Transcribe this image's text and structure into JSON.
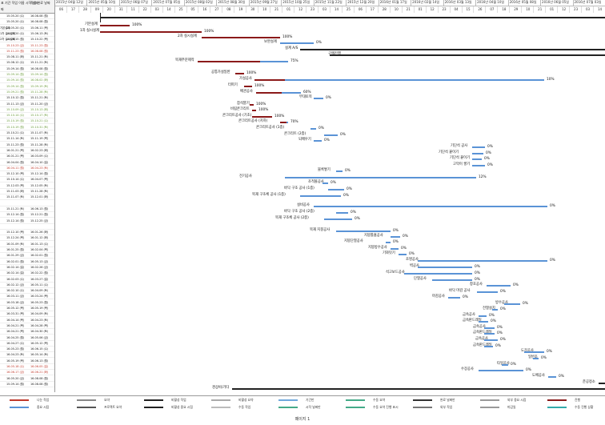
{
  "header": {
    "left_cols": [
      "표 기간 작업 이름 시작 날짜",
      "짜",
      "작업 완료 날짜"
    ],
    "weeks": [
      "2015년 04월 12일",
      "2015년 05월 10일",
      "2015년 06월 07일",
      "2015년 07월 05일",
      "2015년 08월 02일",
      "2015년 08월 30일",
      "2015년 09월 27일",
      "2015년 10월 25일",
      "2015년 11월 22일",
      "2015년 12월 20일",
      "2016년 01월 17일",
      "2016년 02월 14일",
      "2016년 03월 13일",
      "2016년 04월 10일",
      "2016년 05월 08일",
      "2016년 06월 05일",
      "2016년 07월 03일"
    ],
    "days": [
      "06",
      "17",
      "28",
      "09",
      "20",
      "31",
      "11",
      "22",
      "03",
      "14",
      "25",
      "05",
      "16",
      "27",
      "08",
      "19",
      "30",
      "10",
      "21",
      "01",
      "12",
      "23",
      "03",
      "14",
      "25",
      "06",
      "17",
      "28",
      "10",
      "21",
      "01",
      "12",
      "23",
      "04",
      "15",
      "26",
      "07",
      "18",
      "29",
      "10",
      "21",
      "01",
      "12",
      "23",
      "03",
      "14"
    ]
  },
  "rows": [
    {
      "name": "",
      "start": "15-05-20 (수)",
      "end": "16-08-08 (월)",
      "color": "black"
    },
    {
      "name": "",
      "start": "15-05-20 (수)",
      "end": "16-08-08 (월)",
      "color": "black"
    },
    {
      "name": "기본설계",
      "start": "15-05-20 (수)",
      "end": "15-06-11 (목)",
      "color": "black"
    },
    {
      "name": "1차 실시설계",
      "start": "15-05-20 (수)",
      "end": "15-06-13 (토)",
      "color": "black"
    },
    {
      "name": "2차 실시설계",
      "start": "15-06-15 (월)",
      "end": "15-10-22 (목)",
      "color": "black"
    },
    {
      "name": "",
      "start": "15-10-23 (금)",
      "end": "15-11-23 (월)",
      "color": "red"
    },
    {
      "name": "",
      "start": "15-11-23 (월)",
      "end": "16-08-08 (월)",
      "color": "red"
    },
    {
      "name": "",
      "start": "15-08-11 (화)",
      "end": "15-11-21 (토)",
      "color": "black"
    },
    {
      "name": "",
      "start": "15-08-12 (수)",
      "end": "15-11-21 (토)",
      "color": "black"
    },
    {
      "name": "",
      "start": "15-09-14 (월)",
      "end": "16-08-08 (월)",
      "color": "black"
    },
    {
      "name": "",
      "start": "15-09-14 (월)",
      "end": "15-09-14 (월)",
      "color": "green"
    },
    {
      "name": "",
      "start": "15-09-14 (월)",
      "end": "16-08-02 (화)",
      "color": "green"
    },
    {
      "name": "",
      "start": "15-09-14 (월)",
      "end": "15-09-19 (토)",
      "color": "green"
    },
    {
      "name": "",
      "start": "15-09-21 (월)",
      "end": "15-11-28 (토)",
      "color": "green"
    },
    {
      "name": "",
      "start": "15-10-12 (월)",
      "end": "15-11-21 (토)",
      "color": "black"
    },
    {
      "name": "",
      "start": "15-11-13 (금)",
      "end": "15-11-20 (금)",
      "color": "black"
    },
    {
      "name": "",
      "start": "15-10-09 (금)",
      "end": "15-10-13 (화)",
      "color": "green"
    },
    {
      "name": "",
      "start": "15-10-14 (수)",
      "end": "15-10-17 (토)",
      "color": "green"
    },
    {
      "name": "",
      "start": "15-10-19 (월)",
      "end": "15-10-21 (수)",
      "color": "green"
    },
    {
      "name": "",
      "start": "15-10-19 (월)",
      "end": "15-10-31 (토)",
      "color": "green"
    },
    {
      "name": "",
      "start": "15-10-21 (수)",
      "end": "15-11-07 (토)",
      "color": "black"
    },
    {
      "name": "",
      "start": "15-11-14 (토)",
      "end": "15-11-19 (목)",
      "color": "black"
    },
    {
      "name": "",
      "start": "15-11-23 (월)",
      "end": "15-11-28 (토)",
      "color": "black"
    },
    {
      "name": "",
      "start": "16-01-21 (목)",
      "end": "16-02-23 (화)",
      "color": "black"
    },
    {
      "name": "",
      "start": "16-01-21 (목)",
      "end": "16-03-09 (수)",
      "color": "black"
    },
    {
      "name": "",
      "start": "16-04-04 (월)",
      "end": "16-04-10 (일)",
      "color": "black"
    },
    {
      "name": "",
      "start": "16-04-11 (월)",
      "end": "16-04-23 (토)",
      "color": "red"
    },
    {
      "name": "",
      "start": "15-12-10 (목)",
      "end": "15-12-14 (월)",
      "color": "black"
    },
    {
      "name": "",
      "start": "15-10-14 (수)",
      "end": "16-04-07 (목)",
      "color": "black"
    },
    {
      "name": "",
      "start": "15-12-03 (목)",
      "end": "15-12-05 (토)",
      "color": "black"
    },
    {
      "name": "",
      "start": "15-11-03 (화)",
      "end": "15-11-28 (토)",
      "color": "black"
    },
    {
      "name": "",
      "start": "15-11-07 (토)",
      "end": "15-12-01 (화)",
      "color": "black"
    },
    {
      "name": "",
      "start": "",
      "end": "",
      "color": "black"
    },
    {
      "name": "",
      "start": "15-11-21 (토)",
      "end": "16-06-13 (월)",
      "color": "black"
    },
    {
      "name": "",
      "start": "15-12-14 (월)",
      "end": "15-12-21 (월)",
      "color": "black"
    },
    {
      "name": "",
      "start": "15-12-14 (월)",
      "end": "15-12-25 (금)",
      "color": "black"
    },
    {
      "name": "",
      "start": "",
      "end": "",
      "color": "black"
    },
    {
      "name": "",
      "start": "15-12-10 (목)",
      "end": "16-01-26 (화)",
      "color": "black"
    },
    {
      "name": "",
      "start": "15-12-24 (목)",
      "end": "16-01-12 (화)",
      "color": "black"
    },
    {
      "name": "",
      "start": "16-01-09 (토)",
      "end": "16-01-13 (수)",
      "color": "black"
    },
    {
      "name": "",
      "start": "16-01-25 (월)",
      "end": "16-02-04 (목)",
      "color": "black"
    },
    {
      "name": "",
      "start": "16-01-29 (금)",
      "end": "16-02-01 (월)",
      "color": "black"
    },
    {
      "name": "",
      "start": "16-02-01 (월)",
      "end": "16-05-13 (금)",
      "color": "black"
    },
    {
      "name": "",
      "start": "16-02-14 (일)",
      "end": "16-02-26 (금)",
      "color": "black"
    },
    {
      "name": "",
      "start": "16-02-14 (일)",
      "end": "16-02-22 (월)",
      "color": "black"
    },
    {
      "name": "",
      "start": "16-02-03 (수)",
      "end": "16-03-27 (일)",
      "color": "black"
    },
    {
      "name": "",
      "start": "16-02-12 (금)",
      "end": "16-05-11 (수)",
      "color": "black"
    },
    {
      "name": "",
      "start": "16-02-10 (수)",
      "end": "16-04-09 (토)",
      "color": "black"
    },
    {
      "name": "",
      "start": "16-03-11 (금)",
      "end": "16-03-24 (목)",
      "color": "black"
    },
    {
      "name": "",
      "start": "16-03-18 (금)",
      "end": "16-05-23 (월)",
      "color": "black"
    },
    {
      "name": "",
      "start": "16-05-12 (목)",
      "end": "16-05-19 (목)",
      "color": "black"
    },
    {
      "name": "",
      "start": "16-03-31 (목)",
      "end": "16-04-09 (토)",
      "color": "black"
    },
    {
      "name": "",
      "start": "16-04-14 (목)",
      "end": "16-04-23 (토)",
      "color": "black"
    },
    {
      "name": "",
      "start": "16-04-21 (목)",
      "end": "16-04-28 (목)",
      "color": "black"
    },
    {
      "name": "",
      "start": "16-04-21 (목)",
      "end": "16-04-30 (토)",
      "color": "black"
    },
    {
      "name": "",
      "start": "16-04-25 (월)",
      "end": "16-05-06 (금)",
      "color": "black"
    },
    {
      "name": "",
      "start": "16-04-27 (수)",
      "end": "16-05-12 (목)",
      "color": "black"
    },
    {
      "name": "",
      "start": "16-05-23 (월)",
      "end": "16-06-15 (수)",
      "color": "black"
    },
    {
      "name": "",
      "start": "16-04-23 (토)",
      "end": "16-05-14 (토)",
      "color": "black"
    },
    {
      "name": "",
      "start": "16-05-19 (목)",
      "end": "16-06-13 (월)",
      "color": "black"
    },
    {
      "name": "",
      "start": "16-05-18 (수)",
      "end": "16-06-05 (일)",
      "color": "red"
    },
    {
      "name": "",
      "start": "16-06-17 (금)",
      "end": "16-06-21 (화)",
      "color": "red"
    },
    {
      "name": "",
      "start": "16-05-20 (금)",
      "end": "16-08-08 (월)",
      "color": "black"
    },
    {
      "name": "",
      "start": "15-09-14 (월)",
      "end": "16-08-08 (월)",
      "color": "black"
    }
  ],
  "tasks": [
    {
      "label": "기본설계",
      "pct": "100%"
    },
    {
      "label": "1차 실시설계",
      "pct": "100%"
    },
    {
      "label": "2차 실시설계",
      "pct": "100%"
    },
    {
      "label": "보완설계",
      "pct": "0%"
    },
    {
      "label": "설계 A/S",
      "pct": ""
    },
    {
      "label": "구매진행",
      "pct": ""
    },
    {
      "label": "목재주문제작",
      "pct": "75%"
    },
    {
      "label": "공통가설일반",
      "pct": "100%"
    },
    {
      "label": "가설공사",
      "pct": "10%"
    },
    {
      "label": "터파기",
      "pct": "100%"
    },
    {
      "label": "배관공사",
      "pct": "60%"
    },
    {
      "label": "부대토목",
      "pct": "0%"
    },
    {
      "label": "잡석깔기",
      "pct": "100%"
    },
    {
      "label": "비림콘크리트",
      "pct": "100%"
    },
    {
      "label": "콘크리트공사 (기초)",
      "pct": "100%"
    },
    {
      "label": "콘크리트공사 (지하)",
      "pct": "70%"
    },
    {
      "label": "콘크리트공사 (1층)",
      "pct": "0%"
    },
    {
      "label": "콘크리트 (2층)",
      "pct": "0%"
    },
    {
      "label": "되메우기",
      "pct": "0%"
    },
    {
      "label": "기단석 공사",
      "pct": "0%"
    },
    {
      "label": "기단석 붙이기",
      "pct": "0%"
    },
    {
      "label": "기단석 붙이기",
      "pct": "0%"
    },
    {
      "label": "고막이 쌓기",
      "pct": "0%"
    },
    {
      "label": "블록쌓기",
      "pct": "0%"
    },
    {
      "label": "전기공사",
      "pct": "12%"
    },
    {
      "label": "조적몰공사",
      "pct": "0%"
    },
    {
      "label": "바닥 구조 공사 (1층)",
      "pct": "0%"
    },
    {
      "label": "목재 구조체 공사 (1층)",
      "pct": "0%"
    },
    {
      "label": "설비공사",
      "pct": "0%"
    },
    {
      "label": "바닥 구조 공사 (2층)",
      "pct": "0%"
    },
    {
      "label": "목재 구조체 공사 (2층)",
      "pct": "0%"
    },
    {
      "label": "목재 지붕공사",
      "pct": "0%"
    },
    {
      "label": "지붕틀홈공사",
      "pct": "0%"
    },
    {
      "label": "지붕단열공사",
      "pct": "0%"
    },
    {
      "label": "지붕방수공사",
      "pct": "0%"
    },
    {
      "label": "기와잇기",
      "pct": "0%"
    },
    {
      "label": "조명공사",
      "pct": "0%"
    },
    {
      "label": "벽공사",
      "pct": "0%"
    },
    {
      "label": "석고보드공사",
      "pct": "0%"
    },
    {
      "label": "단열공사",
      "pct": "0%"
    },
    {
      "label": "창호공사",
      "pct": "0%"
    },
    {
      "label": "바닥 마감 공사",
      "pct": "0%"
    },
    {
      "label": "마감공사",
      "pct": "0%"
    },
    {
      "label": "방수공사",
      "pct": "0%"
    },
    {
      "label": "전열설치",
      "pct": "0%"
    },
    {
      "label": "금속공사",
      "pct": "0%"
    },
    {
      "label": "금속판드레일",
      "pct": "0%"
    },
    {
      "label": "금속공사",
      "pct": "0%"
    },
    {
      "label": "금속판드레일",
      "pct": "0%"
    },
    {
      "label": "금속공사",
      "pct": "0%"
    },
    {
      "label": "금속판드레일",
      "pct": "0%"
    },
    {
      "label": "도장공사",
      "pct": "0%"
    },
    {
      "label": "일반조",
      "pct": "0%"
    },
    {
      "label": "타일공사",
      "pct": "0%"
    },
    {
      "label": "수장공사",
      "pct": "0%"
    },
    {
      "label": "도배공사",
      "pct": "0%"
    },
    {
      "label": "준공정소",
      "pct": ""
    },
    {
      "label": "경상비/기타",
      "pct": ""
    }
  ],
  "legend": [
    [
      "나눈 작업",
      "요약",
      "비활성 작업",
      "비활성 요약",
      "기간만",
      "수동 요약",
      "완료 날짜만",
      "외부 중요 시점",
      "진행"
    ],
    [
      "중요 시점",
      "프로젝트 요약",
      "비활성 중요 시점",
      "수동 작업",
      "시작 날짜만",
      "수동 요약 진행 표시",
      "외부 작업",
      "마감일",
      "수동 진행 상황"
    ]
  ],
  "footer": {
    "page": "페이지 1"
  },
  "colors": {
    "critical": "#8b1a1a",
    "normal": "#5a93d6",
    "summary": "#222222"
  }
}
